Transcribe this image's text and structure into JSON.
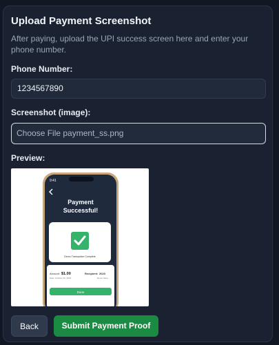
{
  "form": {
    "title": "Upload Payment Screenshot",
    "subtitle": "After paying, upload the UPI success screen here and enter your phone number.",
    "phone_label": "Phone Number:",
    "phone_value": "1234567890",
    "screenshot_label": "Screenshot (image):",
    "file_input_text": "Choose File payment_ss.png",
    "preview_label": "Preview:",
    "back_label": "Back",
    "submit_label": "Submit Payment Proof"
  },
  "preview_phone": {
    "time": "9:41",
    "heading_line1": "Payment",
    "heading_line2": "Successful!",
    "transaction_text": "Demo Transaction Complete",
    "amount_label": "Amount:",
    "amount_value": "$1.00",
    "date_text": "Date: October 26, 2023",
    "recipient_label": "Recipient:",
    "recipient_value": "2023",
    "recipient_name": "Demo Store",
    "done_label": "Done"
  },
  "colors": {
    "background": "#111723",
    "card": "#1a2231",
    "accent_green": "#1b8a42",
    "check_green": "#35b36a"
  }
}
